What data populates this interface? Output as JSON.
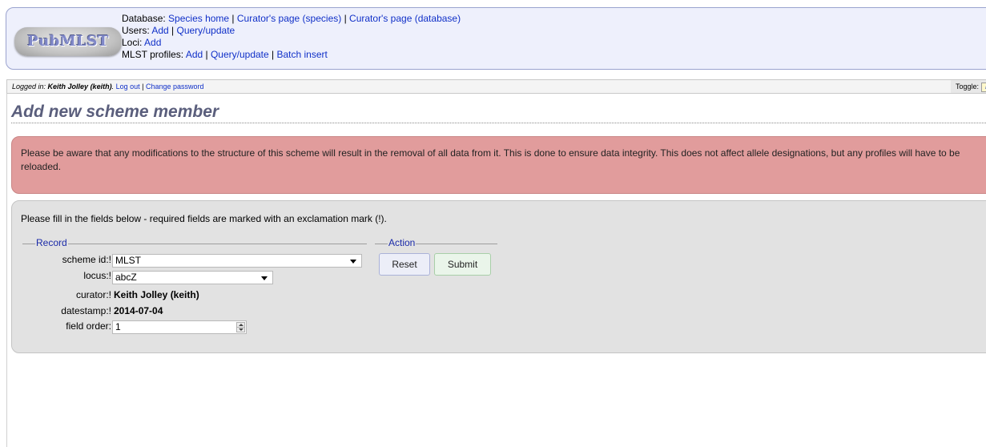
{
  "header": {
    "logo_text": "PubMLST",
    "database": {
      "label": "Database:",
      "links": [
        "Species home",
        "Curator's page (species)",
        "Curator's page (database)"
      ]
    },
    "users": {
      "label": "Users:",
      "links": [
        "Add",
        "Query/update"
      ]
    },
    "loci": {
      "label": "Loci:",
      "links": [
        "Add"
      ]
    },
    "mlst_profiles": {
      "label": "MLST profiles:",
      "links": [
        "Add",
        "Query/update",
        "Batch insert"
      ]
    },
    "separator": " | "
  },
  "login_bar": {
    "prefix": "Logged in: ",
    "user": "Keith Jolley (keith)",
    "period": ".",
    "logout": "Log out",
    "separator": " | ",
    "change_password": "Change password",
    "toggle_label": "Toggle:",
    "toggle_icon": "i"
  },
  "page_title": "Add new scheme member",
  "warning_text": "Please be aware that any modifications to the structure of this scheme will result in the removal of all data from it. This is done to ensure data integrity. This does not affect allele designations, but any profiles will have to be reloaded.",
  "form": {
    "intro": "Please fill in the fields below - required fields are marked with an exclamation mark (!).",
    "record_legend": "Record",
    "action_legend": "Action",
    "fields": {
      "scheme_id": {
        "label": "scheme id:!",
        "value": "MLST"
      },
      "locus": {
        "label": "locus:!",
        "value": "abcZ"
      },
      "curator": {
        "label": "curator:!",
        "value": "Keith Jolley (keith)"
      },
      "datestamp": {
        "label": "datestamp:!",
        "value": "2014-07-04"
      },
      "field_order": {
        "label": "field order:",
        "value": "1"
      }
    },
    "reset_label": "Reset",
    "submit_label": "Submit"
  },
  "icons": {
    "dropdown": "chevron-down-icon",
    "spinner": "spinner-arrows-icon",
    "info": "info-icon"
  },
  "colors": {
    "header_bg": "#eef0fc",
    "link": "#1030c8",
    "warning_bg": "#e19c9c",
    "panel_bg": "#e2e2e2",
    "title": "#5a5e7c",
    "legend": "#1a2aa8"
  }
}
